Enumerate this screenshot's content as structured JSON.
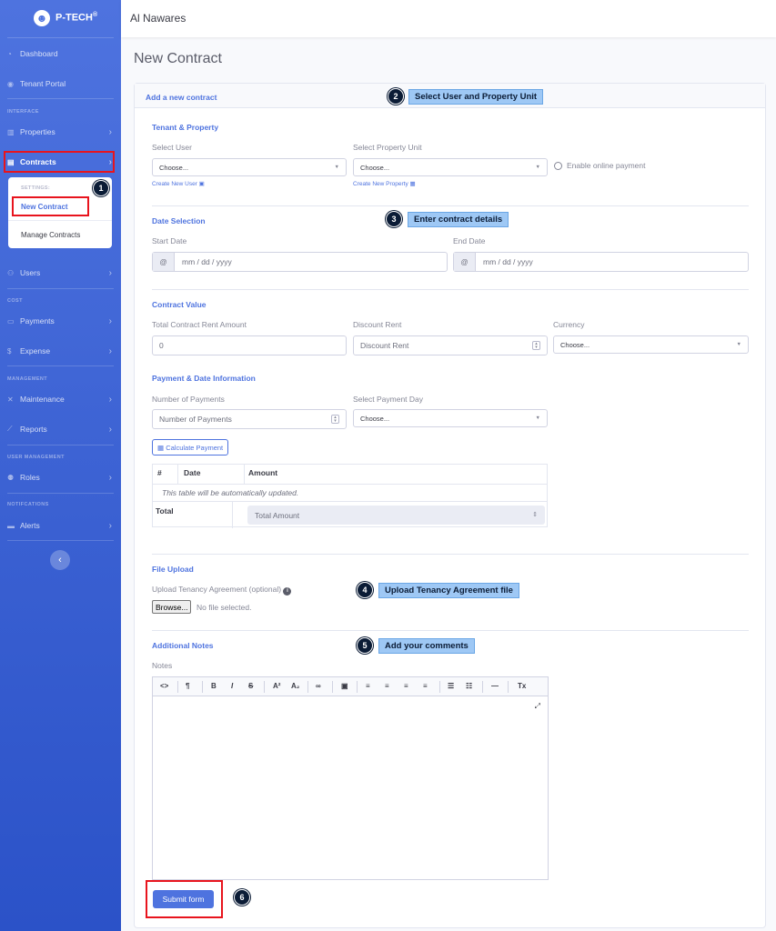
{
  "brand": {
    "logo": "smiley-logo",
    "name": "P-TECH",
    "mark": "®"
  },
  "topbar": {
    "user": "Al Nawares"
  },
  "sidebar": {
    "items": [
      {
        "icon": "dashboard-icon",
        "label": "Dashboard"
      },
      {
        "icon": "portal-icon",
        "label": "Tenant Portal"
      },
      {
        "heading": "INTERFACE"
      },
      {
        "icon": "building-icon",
        "label": "Properties"
      },
      {
        "icon": "file-icon",
        "label": "Contracts"
      },
      {
        "icon": "users-icon",
        "label": "Users"
      },
      {
        "heading": "COST"
      },
      {
        "icon": "money-icon",
        "label": "Payments"
      },
      {
        "icon": "dollar-icon",
        "label": "Expense"
      },
      {
        "heading": "MANAGEMENT"
      },
      {
        "icon": "tools-icon",
        "label": "Maintenance"
      },
      {
        "icon": "chart-icon",
        "label": "Reports"
      },
      {
        "heading": "USER MANAGEMENT"
      },
      {
        "icon": "roles-icon",
        "label": "Roles"
      },
      {
        "heading": "NOTIFCATIONS"
      },
      {
        "icon": "alerts-icon",
        "label": "Alerts"
      }
    ],
    "submenu": {
      "heading": "SETTINGS:",
      "items": [
        "New Contract",
        "Manage Contracts"
      ]
    },
    "toggle": "‹"
  },
  "page": {
    "title": "New Contract",
    "card_header": "Add a new contract"
  },
  "tenant": {
    "section": "Tenant & Property",
    "select_user_label": "Select User",
    "select_user_value": "Choose...",
    "create_user": "Create New User",
    "select_unit_label": "Select Property Unit",
    "select_unit_value": "Choose...",
    "create_property": "Create New Property",
    "online_payment": "Enable online payment"
  },
  "dates": {
    "section": "Date Selection",
    "start_label": "Start Date",
    "start_placeholder": "mm / dd / yyyy",
    "end_label": "End Date",
    "end_placeholder": "mm / dd / yyyy",
    "addon": "@"
  },
  "value": {
    "section": "Contract Value",
    "total_label": "Total Contract Rent Amount",
    "total_value": "0",
    "discount_label": "Discount Rent",
    "discount_placeholder": "Discount Rent",
    "currency_label": "Currency",
    "currency_value": "Choose..."
  },
  "payment": {
    "section": "Payment & Date Information",
    "num_label": "Number of Payments",
    "num_placeholder": "Number of Payments",
    "day_label": "Select Payment Day",
    "day_value": "Choose...",
    "calc_button": "Calculate Payment",
    "table": {
      "headers": [
        "#",
        "Date",
        "Amount"
      ],
      "note": "This table will be automatically updated.",
      "total_label": "Total",
      "total_placeholder": "Total  Amount"
    }
  },
  "upload": {
    "section": "File Upload",
    "label": "Upload Tenancy Agreement (optional)",
    "browse": "Browse...",
    "no_file": "No file selected."
  },
  "notes": {
    "section": "Additional Notes",
    "label": "Notes"
  },
  "submit": "Submit form",
  "callouts": [
    {
      "num": "1"
    },
    {
      "num": "2",
      "text": "Select User and Property Unit"
    },
    {
      "num": "3",
      "text": "Enter contract details"
    },
    {
      "num": "4",
      "text": "Upload Tenancy Agreement file"
    },
    {
      "num": "5",
      "text": "Add your comments"
    },
    {
      "num": "6"
    }
  ],
  "colors": {
    "primary": "#4e73df",
    "highlight": "#e8141d",
    "callout": "#9ec8f5"
  }
}
